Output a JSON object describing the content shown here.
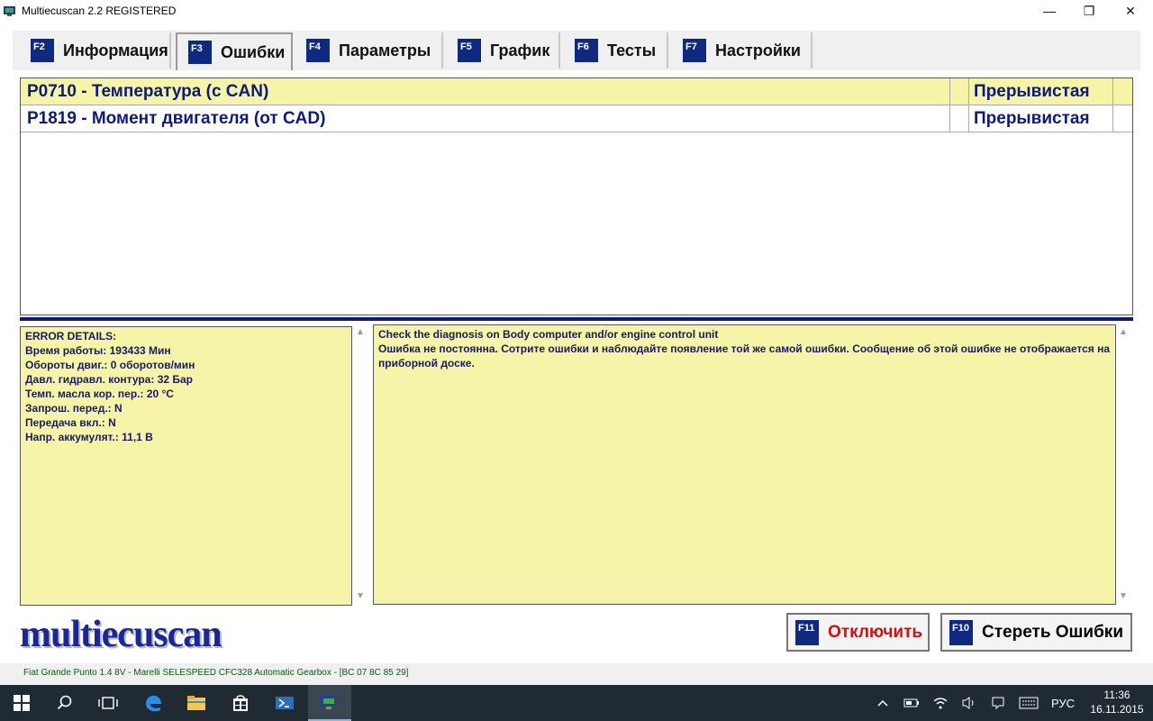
{
  "window": {
    "title": "Multiecuscan 2.2 REGISTERED"
  },
  "tabs": [
    {
      "key": "F2",
      "label": "Информация",
      "active": false
    },
    {
      "key": "F3",
      "label": "Ошибки",
      "active": true
    },
    {
      "key": "F4",
      "label": "Параметры",
      "active": false
    },
    {
      "key": "F5",
      "label": "График",
      "active": false
    },
    {
      "key": "F6",
      "label": "Тесты",
      "active": false
    },
    {
      "key": "F7",
      "label": "Настройки",
      "active": false
    }
  ],
  "errors": [
    {
      "code": "P0710 - Температура (с CAN)",
      "status": "Прерывистая"
    },
    {
      "code": "P1819 - Момент двигателя (от CAD)",
      "status": "Прерывистая"
    }
  ],
  "details": {
    "lines": [
      "ERROR DETAILS:",
      "Время работы: 193433 Мин",
      "Обороты двиг.: 0 оборотов/мин",
      "Давл. гидравл. контура: 32 Бар",
      "Темп. масла кор. пер.: 20 °C",
      "Запрош. перед.: N",
      "Передача вкл.: N",
      "Напр. аккумулят.: 11,1 В"
    ]
  },
  "description": {
    "line1": "Check the diagnosis on Body computer and/or engine control unit",
    "line2": "Ошибка не постоянна. Сотрите ошибки и наблюдайте появление той же самой ошибки. Сообщение об этой ошибке не отображается на приборной доске."
  },
  "logo": "multiecuscan",
  "buttons": {
    "disconnect": {
      "key": "F11",
      "label": "Отключить",
      "color": "#d01010"
    },
    "clear": {
      "key": "F10",
      "label": "Стереть Ошибки",
      "color": "#000000"
    }
  },
  "status": "Fiat Grande Punto 1.4 8V - Marelli SELESPEED CFC328 Automatic Gearbox - [BC 07 8C 85 29]",
  "taskbar": {
    "lang": "РУС",
    "time": "11:36",
    "date": "16.11.2015"
  }
}
